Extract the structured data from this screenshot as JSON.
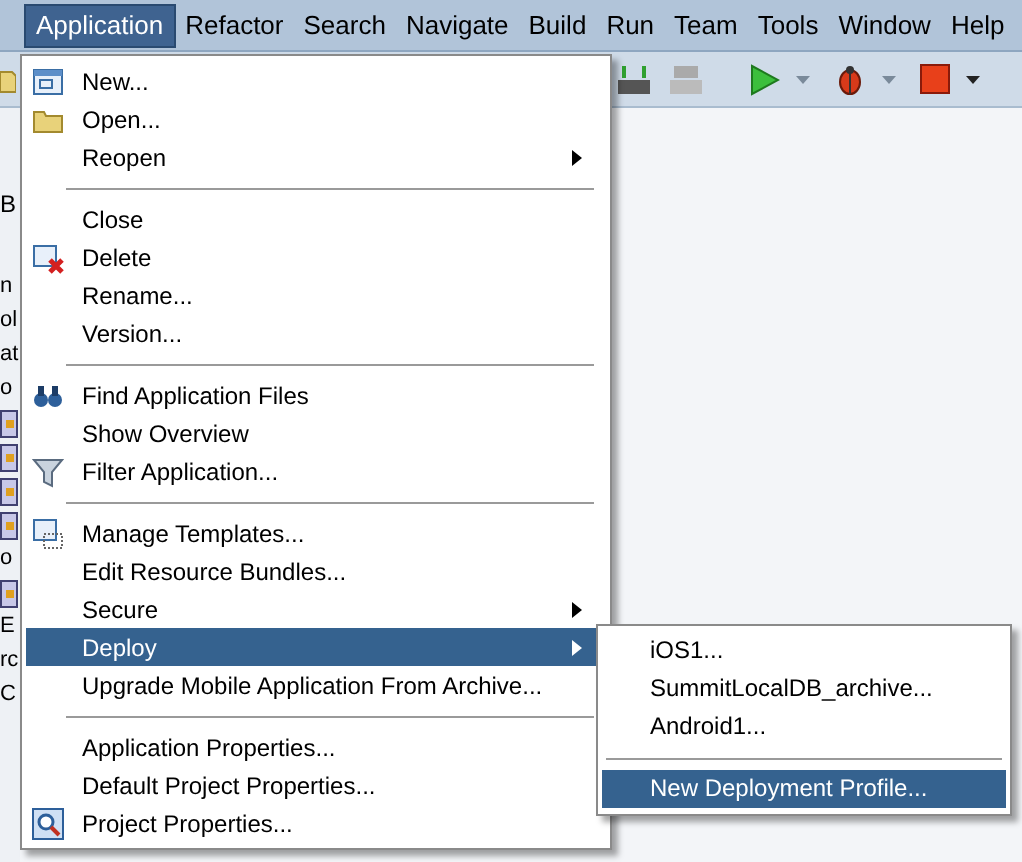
{
  "menubar": [
    {
      "label": "Application",
      "selected": true
    },
    {
      "label": "Refactor",
      "selected": false
    },
    {
      "label": "Search",
      "selected": false
    },
    {
      "label": "Navigate",
      "selected": false
    },
    {
      "label": "Build",
      "selected": false
    },
    {
      "label": "Run",
      "selected": false
    },
    {
      "label": "Team",
      "selected": false
    },
    {
      "label": "Tools",
      "selected": false
    },
    {
      "label": "Window",
      "selected": false
    },
    {
      "label": "Help",
      "selected": false
    }
  ],
  "background_panel": {
    "tab_fragment": "B",
    "fragments": [
      {
        "kind": "text",
        "text": "n"
      },
      {
        "kind": "text",
        "text": "ol"
      },
      {
        "kind": "text",
        "text": "at"
      },
      {
        "kind": "text",
        "text": "o"
      },
      {
        "kind": "icon"
      },
      {
        "kind": "icon"
      },
      {
        "kind": "icon"
      },
      {
        "kind": "icon"
      },
      {
        "kind": "text",
        "text": "o"
      },
      {
        "kind": "icon"
      },
      {
        "kind": "text",
        "text": "E"
      },
      {
        "kind": "text",
        "text": "rc"
      },
      {
        "kind": "text",
        "text": "C"
      }
    ]
  },
  "menu": [
    {
      "kind": "item",
      "label": "New...",
      "submenu": false,
      "selected": false
    },
    {
      "kind": "item",
      "label": "Open...",
      "submenu": false,
      "selected": false
    },
    {
      "kind": "item",
      "label": "Reopen",
      "submenu": true,
      "selected": false
    },
    {
      "kind": "separator"
    },
    {
      "kind": "item",
      "label": "Close",
      "submenu": false,
      "selected": false
    },
    {
      "kind": "item",
      "label": "Delete",
      "submenu": false,
      "selected": false
    },
    {
      "kind": "item",
      "label": "Rename...",
      "submenu": false,
      "selected": false
    },
    {
      "kind": "item",
      "label": "Version...",
      "submenu": false,
      "selected": false
    },
    {
      "kind": "separator"
    },
    {
      "kind": "item",
      "label": "Find Application Files",
      "submenu": false,
      "selected": false
    },
    {
      "kind": "item",
      "label": "Show Overview",
      "submenu": false,
      "selected": false
    },
    {
      "kind": "item",
      "label": "Filter Application...",
      "submenu": false,
      "selected": false
    },
    {
      "kind": "separator"
    },
    {
      "kind": "item",
      "label": "Manage Templates...",
      "submenu": false,
      "selected": false
    },
    {
      "kind": "item",
      "label": "Edit Resource Bundles...",
      "submenu": false,
      "selected": false
    },
    {
      "kind": "item",
      "label": "Secure",
      "submenu": true,
      "selected": false
    },
    {
      "kind": "item",
      "label": "Deploy",
      "submenu": true,
      "selected": true
    },
    {
      "kind": "item",
      "label": "Upgrade Mobile Application From Archive...",
      "submenu": false,
      "selected": false
    },
    {
      "kind": "separator"
    },
    {
      "kind": "item",
      "label": "Application Properties...",
      "submenu": false,
      "selected": false
    },
    {
      "kind": "item",
      "label": "Default Project Properties...",
      "submenu": false,
      "selected": false
    },
    {
      "kind": "item",
      "label": "Project Properties...",
      "submenu": false,
      "selected": false
    }
  ],
  "submenu": [
    {
      "kind": "item",
      "label": "iOS1...",
      "selected": false
    },
    {
      "kind": "item",
      "label": "SummitLocalDB_archive...",
      "selected": false
    },
    {
      "kind": "item",
      "label": "Android1...",
      "selected": false
    },
    {
      "kind": "separator"
    },
    {
      "kind": "item",
      "label": "New Deployment Profile...",
      "selected": true
    }
  ]
}
